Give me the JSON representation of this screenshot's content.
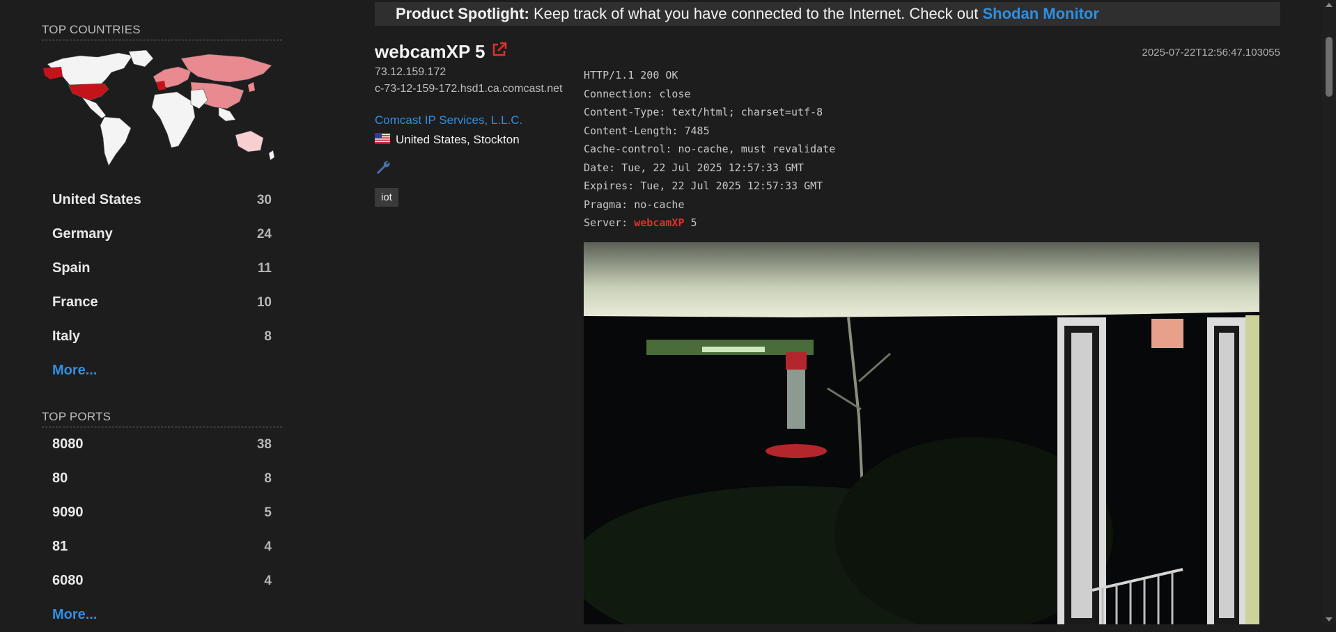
{
  "sidebar": {
    "top_countries_title": "TOP COUNTRIES",
    "countries": [
      {
        "name": "United States",
        "count": "30"
      },
      {
        "name": "Germany",
        "count": "24"
      },
      {
        "name": "Spain",
        "count": "11"
      },
      {
        "name": "France",
        "count": "10"
      },
      {
        "name": "Italy",
        "count": "8"
      }
    ],
    "countries_more": "More...",
    "top_ports_title": "TOP PORTS",
    "ports": [
      {
        "name": "8080",
        "count": "38"
      },
      {
        "name": "80",
        "count": "8"
      },
      {
        "name": "9090",
        "count": "5"
      },
      {
        "name": "81",
        "count": "4"
      },
      {
        "name": "6080",
        "count": "4"
      }
    ],
    "ports_more": "More..."
  },
  "spotlight": {
    "label": "Product Spotlight:",
    "text": " Keep track of what you have connected to the Internet. Check out ",
    "link": "Shodan Monitor"
  },
  "result": {
    "title": "webcamXP 5",
    "timestamp": "2025-07-22T12:56:47.103055",
    "ip": "73.12.159.172",
    "hostname": "c-73-12-159-172.hsd1.ca.comcast.net",
    "org": "Comcast IP Services, L.L.C.",
    "location": "United States, Stockton",
    "tag": "iot",
    "banner_lines": [
      "HTTP/1.1 200 OK",
      "Connection: close",
      "Content-Type: text/html; charset=utf-8",
      "Content-Length: 7485",
      "Cache-control: no-cache, must revalidate",
      "Date: Tue, 22 Jul 2025 12:57:33 GMT",
      "Expires: Tue, 22 Jul 2025 12:57:33 GMT",
      "Pragma: no-cache"
    ],
    "server_label": "Server: ",
    "server_product": "webcamXP",
    "server_version": " 5"
  },
  "colors": {
    "accent_link": "#2f8fe3",
    "highlight_red": "#e0312b",
    "map_strong": "#c4141b",
    "map_light": "#e88a8f"
  }
}
